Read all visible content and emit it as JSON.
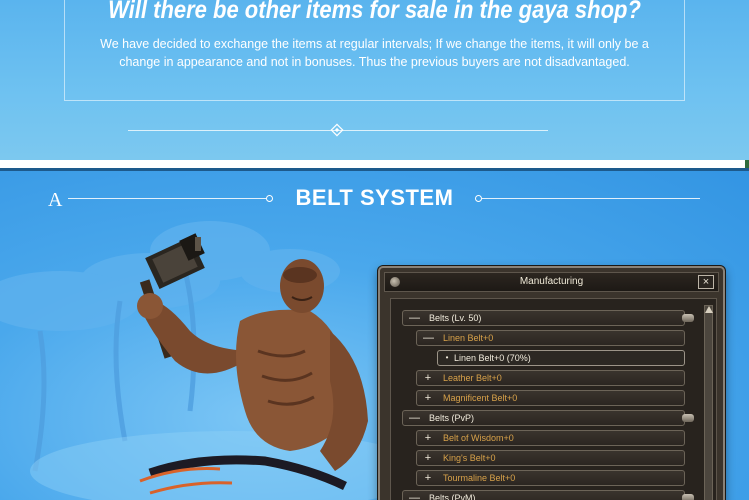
{
  "faq": {
    "title": "Will there be other items for sale in the gaya shop?",
    "text": "We have decided to exchange the items at regular intervals; If we change the items, it will only be a change in appearance and not in bonuses. Thus the previous buyers are not disadvantaged."
  },
  "belt_section": {
    "logo_letter": "A",
    "title": "BELT SYSTEM"
  },
  "window": {
    "title": "Manufacturing",
    "close_symbol": "×",
    "rows": [
      {
        "type": "cat",
        "symbol": "—",
        "label": "Belts (Lv. 50)"
      },
      {
        "type": "item",
        "symbol": "—",
        "label": "Linen Belt+0"
      },
      {
        "type": "sel",
        "symbol": "•",
        "label": "Linen Belt+0 (70%)"
      },
      {
        "type": "item",
        "symbol": "+",
        "label": "Leather Belt+0"
      },
      {
        "type": "item",
        "symbol": "+",
        "label": "Magnificent Belt+0"
      },
      {
        "type": "cat",
        "symbol": "—",
        "label": "Belts (PvP)"
      },
      {
        "type": "item",
        "symbol": "+",
        "label": "Belt of Wisdom+0"
      },
      {
        "type": "item",
        "symbol": "+",
        "label": "King's Belt+0"
      },
      {
        "type": "item",
        "symbol": "+",
        "label": "Tourmaline Belt+0"
      },
      {
        "type": "cat",
        "symbol": "—",
        "label": "Belts (PvM)"
      }
    ]
  },
  "colors": {
    "accent_blue": "#3f9ee6",
    "item_gold": "#d8a24a"
  },
  "icons": [
    "diamond-divider-icon",
    "pin-icon",
    "close-icon",
    "minus-icon",
    "plus-icon",
    "scroll-up-icon"
  ]
}
